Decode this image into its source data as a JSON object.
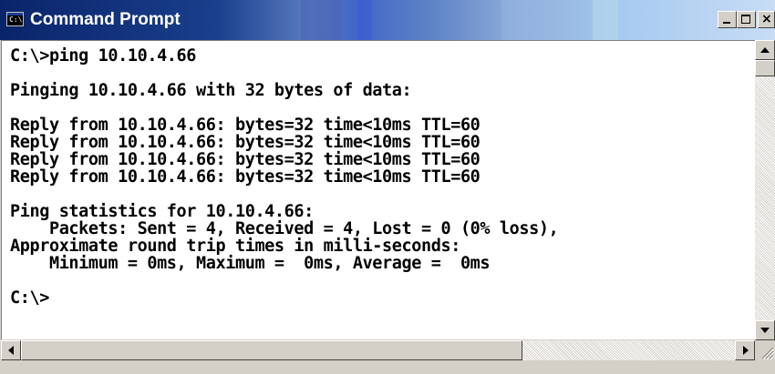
{
  "window": {
    "title": "Command Prompt",
    "icon_label": "C:\\",
    "controls": {
      "minimize": "minimize-icon",
      "maximize": "maximize-icon",
      "close": "close-icon"
    }
  },
  "console": {
    "text": "C:\\>ping 10.10.4.66\n\nPinging 10.10.4.66 with 32 bytes of data:\n\nReply from 10.10.4.66: bytes=32 time<10ms TTL=60\nReply from 10.10.4.66: bytes=32 time<10ms TTL=60\nReply from 10.10.4.66: bytes=32 time<10ms TTL=60\nReply from 10.10.4.66: bytes=32 time<10ms TTL=60\n\nPing statistics for 10.10.4.66:\n    Packets: Sent = 4, Received = 4, Lost = 0 (0% loss),\nApproximate round trip times in milli-seconds:\n    Minimum = 0ms, Maximum =  0ms, Average =  0ms\n\nC:\\>"
  },
  "scrollbars": {
    "vertical": {
      "up_icon": "arrow-up-icon",
      "down_icon": "arrow-down-icon"
    },
    "horizontal": {
      "left_icon": "arrow-left-icon",
      "right_icon": "arrow-right-icon"
    }
  },
  "colors": {
    "title_bar_start": "#0a246a",
    "title_bar_end": "#a6caf0",
    "console_background": "#ffffff",
    "console_text": "#000000",
    "chrome": "#d4d0c8"
  }
}
